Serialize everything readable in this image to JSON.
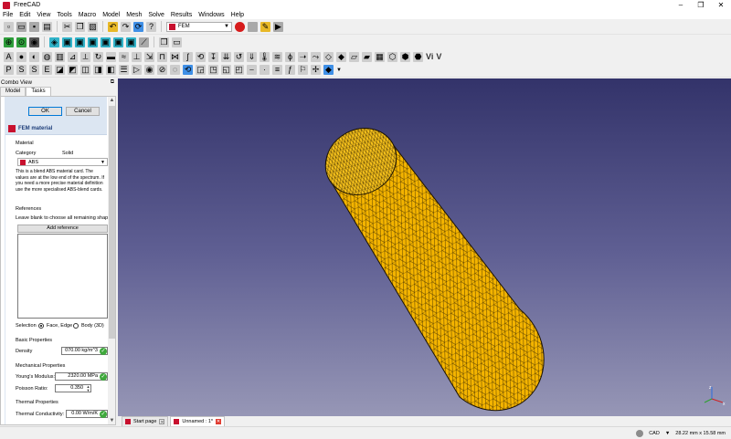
{
  "window": {
    "title": "FreeCAD",
    "controls": [
      "–",
      "❐",
      "✕"
    ]
  },
  "menu": [
    "File",
    "Edit",
    "View",
    "Tools",
    "Macro",
    "Model",
    "Mesh",
    "Solve",
    "Results",
    "Windows",
    "Help"
  ],
  "toolbar": {
    "workbench": "FEM",
    "text_icon_vi": "Vi",
    "text_icon_v": "V"
  },
  "combo_view": {
    "title": "Combo View",
    "tabs": [
      "Model",
      "Tasks"
    ],
    "ok_label": "OK",
    "cancel_label": "Cancel",
    "panel_title": "FEM material",
    "material_section": "Material",
    "category_label": "Category",
    "category_value": "Solid",
    "material_value": "ABS",
    "description": "This is a blend ABS material card. The values are at the low end of the spectrum. If you need a more precise material definition use the more specialised ABS-blend cards.",
    "references_section": "References",
    "references_hint": "Leave blank to choose all remaining shapes",
    "add_reference": "Add reference",
    "selection_label": "Selection",
    "selection_face": "Face, Edge",
    "selection_body": "Body (3D)",
    "basic_properties": "Basic Properties",
    "density_label": "Density",
    "density_value": "070.00 kg/m^3",
    "mechanical_properties": "Mechanical Properties",
    "youngs_label": "Young's Modulus:",
    "youngs_value": "2320.00 MPa",
    "poisson_label": "Poisson Ratio:",
    "poisson_value": "0.350",
    "thermal_properties": "Thermal  Properties",
    "thermal_label": "Thermal Conductivity:",
    "thermal_value": "0.00 W/m/K"
  },
  "doc_tabs": [
    {
      "label": "Start page"
    },
    {
      "label": "Unnamed : 1*"
    }
  ],
  "status": {
    "nav": "CAD",
    "dimensions": "28.22 mm x 15.58 mm"
  },
  "colors": {
    "mesh_fill": "#f4b400",
    "mesh_edge": "#2a1c00",
    "viewport_top": "#33336a",
    "viewport_bottom": "#9a9ab8"
  }
}
